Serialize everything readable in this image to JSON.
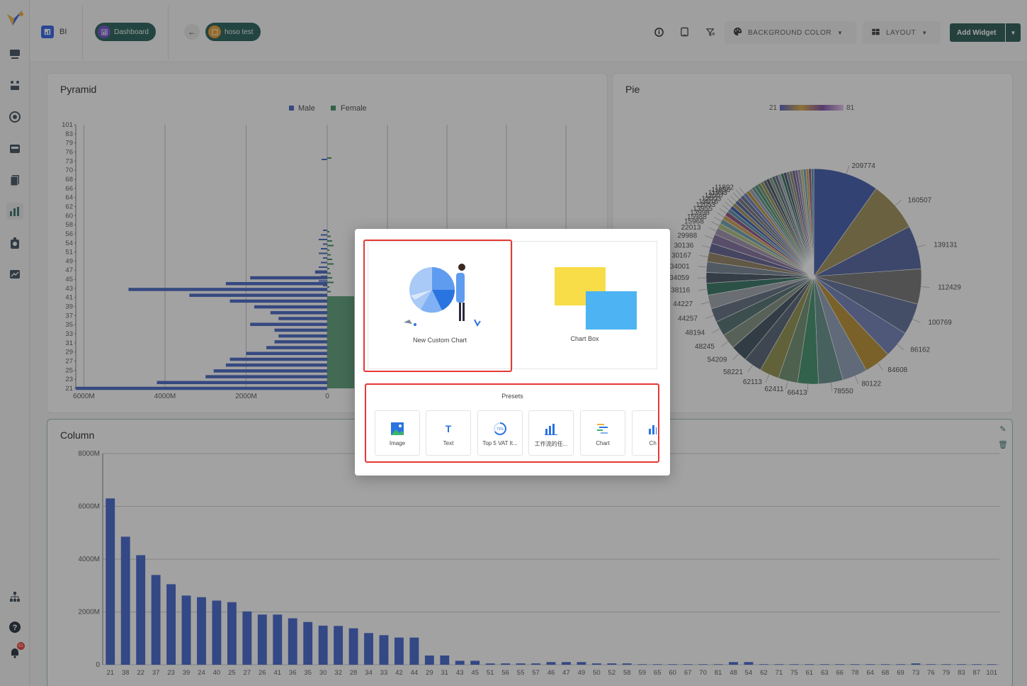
{
  "topbar": {
    "app_label": "BI",
    "dashboard_label": "Dashboard",
    "page_label": "hoso test",
    "background_color_label": "BACKGROUND COLOR",
    "layout_label": "LAYOUT",
    "add_widget_label": "Add Widget"
  },
  "sidebar": {
    "icons": [
      "logo",
      "monitor-icon",
      "org-grid-icon",
      "target-icon",
      "inbox-icon",
      "documents-icon",
      "bar-chart-icon",
      "stopwatch-icon",
      "trend-chart-icon",
      "sitemap-icon",
      "help-icon",
      "bell-icon"
    ],
    "notification_count": "51"
  },
  "colors": {
    "male": "#3f5fbf",
    "female": "#3a8a5c",
    "column": "#3c5fc9",
    "accent": "#1f5b54",
    "highlight": "#e53935"
  },
  "charts": {
    "pyramid": {
      "title": "Pyramid",
      "legend": [
        "Male",
        "Female"
      ]
    },
    "pie": {
      "title": "Pie",
      "range_min": "21",
      "range_max": "81"
    },
    "column": {
      "title": "Column"
    }
  },
  "chart_data": [
    {
      "type": "bar",
      "title": "Pyramid",
      "orientation": "horizontal",
      "legend": [
        "Male",
        "Female"
      ],
      "legend_position": "top-center",
      "y_tick_labels": [
        "101",
        "83",
        "79",
        "76",
        "73",
        "70",
        "68",
        "66",
        "64",
        "62",
        "60",
        "58",
        "56",
        "54",
        "51",
        "49",
        "47",
        "45",
        "43",
        "41",
        "39",
        "37",
        "35",
        "33",
        "31",
        "29",
        "27",
        "25",
        "23",
        "21"
      ],
      "x_tick_labels": [
        "6000M",
        "4000M",
        "2000M",
        "0"
      ],
      "xlim": [
        -6200,
        0
      ],
      "categories": [
        "43",
        "41",
        "39",
        "38",
        "37",
        "36",
        "35",
        "34",
        "33",
        "32",
        "31",
        "30",
        "29",
        "28",
        "27",
        "26",
        "25",
        "24",
        "23",
        "22",
        "21"
      ],
      "series": [
        {
          "name": "Male",
          "values": [
            300,
            1900,
            2500,
            4900,
            3400,
            2400,
            1800,
            1400,
            1200,
            1900,
            1300,
            1200,
            1300,
            1500,
            2000,
            2400,
            2500,
            2800,
            3000,
            4200,
            6200
          ]
        }
      ],
      "grid": true
    },
    {
      "type": "pie",
      "title": "Pie",
      "label_values": [
        "209774",
        "160507",
        "139131",
        "112429",
        "100769",
        "86162",
        "84608",
        "80122",
        "78550",
        "66413",
        "62411",
        "62113",
        "58221",
        "54209",
        "48245",
        "48194",
        "44257",
        "44227",
        "38116",
        "34059",
        "34001",
        "30167",
        "30136",
        "29988",
        "22013",
        "15968",
        "15988",
        "13998",
        "13955",
        "12053",
        "12016",
        "12003",
        "12007",
        "11993",
        "11856",
        "11892"
      ],
      "visual_map_range": [
        "21",
        "81"
      ]
    },
    {
      "type": "bar",
      "title": "Column",
      "y_tick_labels": [
        "8000M",
        "6000M",
        "4000M",
        "2000M",
        "0"
      ],
      "ylim": [
        0,
        8000
      ],
      "categories": [
        "21",
        "38",
        "22",
        "37",
        "23",
        "39",
        "24",
        "40",
        "25",
        "27",
        "26",
        "41",
        "36",
        "35",
        "30",
        "32",
        "28",
        "34",
        "33",
        "42",
        "44",
        "29",
        "31",
        "43",
        "45",
        "51",
        "56",
        "55",
        "57",
        "46",
        "47",
        "49",
        "50",
        "52",
        "58",
        "59",
        "65",
        "60",
        "67",
        "70",
        "81",
        "48",
        "54",
        "62",
        "71",
        "75",
        "61",
        "63",
        "66",
        "78",
        "64",
        "68",
        "69",
        "73",
        "76",
        "79",
        "83",
        "87",
        "101"
      ],
      "values": [
        6300,
        4850,
        4150,
        3400,
        3050,
        2620,
        2560,
        2430,
        2370,
        2020,
        1900,
        1900,
        1760,
        1620,
        1480,
        1470,
        1380,
        1200,
        1120,
        1030,
        1030,
        350,
        350,
        150,
        150,
        50,
        50,
        50,
        50,
        100,
        100,
        100,
        50,
        50,
        50,
        20,
        20,
        20,
        20,
        20,
        20,
        100,
        100,
        20,
        20,
        20,
        20,
        20,
        20,
        20,
        20,
        20,
        20,
        50,
        20,
        20,
        20,
        20,
        20
      ],
      "grid": true
    }
  ],
  "modal": {
    "new_custom_chart_label": "New Custom Chart",
    "chart_box_label": "Chart Box",
    "presets_title": "Presets",
    "presets": [
      {
        "label": "Image",
        "icon": "image-icon"
      },
      {
        "label": "Text",
        "icon": "text-icon"
      },
      {
        "label": "Top 5 VAT It...",
        "icon": "gauge-icon"
      },
      {
        "label": "工作流的任...",
        "icon": "bar-chart-icon"
      },
      {
        "label": "Chart",
        "icon": "gantt-chart-icon"
      },
      {
        "label": "Cha",
        "icon": "bar-chart-icon"
      }
    ]
  }
}
